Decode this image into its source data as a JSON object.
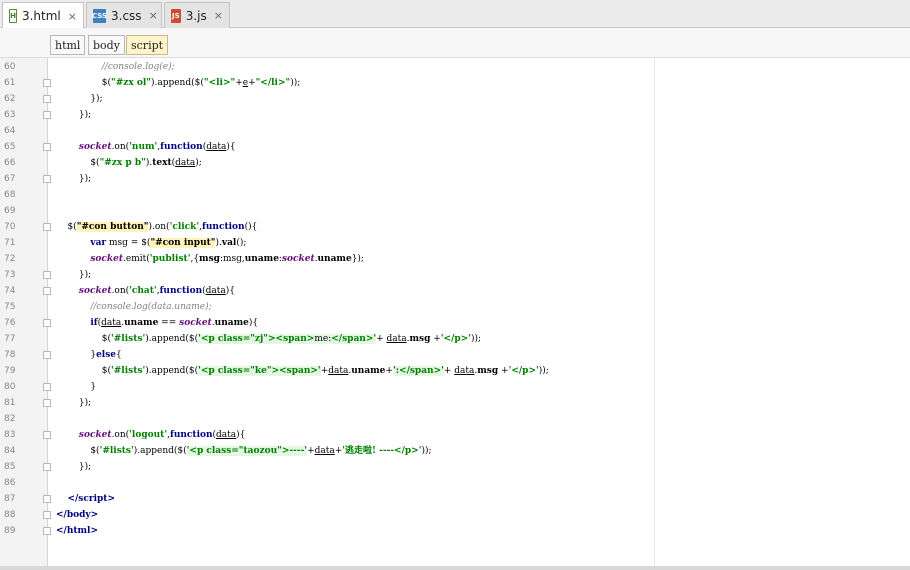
{
  "tabs": [
    {
      "label": "3.html",
      "icon": "html-file-icon",
      "active": true
    },
    {
      "label": "3.css",
      "icon": "css-file-icon",
      "active": false
    },
    {
      "label": "3.js",
      "icon": "js-file-icon",
      "active": false
    }
  ],
  "tab_icon_text": {
    "html": "H",
    "css": "CSS",
    "js": "JS"
  },
  "close_glyph": "×",
  "breadcrumbs": [
    "html",
    "body",
    "script"
  ],
  "code_lines": [
    {
      "n": "60",
      "html": "<span class=\"cmt\">                //console.log(e);</span>"
    },
    {
      "n": "61",
      "html": "                $(<span class=\"str\">\"#zx ol\"</span>).append($(<span class=\"str\">\"&lt;li&gt;\"</span>+<span class=\"ul\">e</span>+<span class=\"str\">\"&lt;/li&gt;\"</span>));"
    },
    {
      "n": "62",
      "html": "            });"
    },
    {
      "n": "63",
      "html": "        });"
    },
    {
      "n": "64",
      "html": ""
    },
    {
      "n": "65",
      "html": "        <span class=\"ital\">socket</span>.on(<span class=\"str\">'num'</span>,<span class=\"kw\">function</span>(<span class=\"ul\">data</span>){"
    },
    {
      "n": "66",
      "html": "            $(<span class=\"str\">\"#zx p b\"</span>).<span class=\"fn\">text</span>(<span class=\"ul\">data</span>);"
    },
    {
      "n": "67",
      "html": "        });"
    },
    {
      "n": "68",
      "html": ""
    },
    {
      "n": "69",
      "html": ""
    },
    {
      "n": "70",
      "html": "    $(<span class=\"sel\">\"#con button\"</span>).on(<span class=\"str\">'click'</span>,<span class=\"kw\">function</span>(){"
    },
    {
      "n": "71",
      "html": "            <span class=\"kw\">var</span> msg = $(<span class=\"sel\">\"#con input\"</span>).<span class=\"fn\">val</span>();"
    },
    {
      "n": "72",
      "html": "            <span class=\"ital\">socket</span>.emit(<span class=\"str\">'publist'</span>,{<span class=\"fn\">msg</span>:msg,<span class=\"fn\">uname</span>:<span class=\"ital\">socket</span>.<span class=\"fn\">uname</span>});"
    },
    {
      "n": "73",
      "html": "        });"
    },
    {
      "n": "74",
      "html": "        <span class=\"ital\">socket</span>.on(<span class=\"str\">'chat'</span>,<span class=\"kw\">function</span>(<span class=\"ul\">data</span>){"
    },
    {
      "n": "75",
      "html": "<span class=\"cmt\">            //console.log(data.uname);</span>"
    },
    {
      "n": "76",
      "html": "            <span class=\"kw\">if</span>(<span class=\"ul\">data</span>.<span class=\"fn\">uname</span> == <span class=\"ital\">socket</span>.<span class=\"fn\">uname</span>){"
    },
    {
      "n": "77",
      "html": "                $(<span class=\"str\">'#lists'</span>).append($(<span class=\"grn\"><span class=\"str\">'&lt;p class=\"zj\"&gt;&lt;span&gt;</span>me:<span class=\"str\">&lt;/span&gt;'</span></span>+ <span class=\"ul\">data</span>.<span class=\"fn\">msg</span> +<span class=\"str\">'&lt;/p&gt;'</span>));"
    },
    {
      "n": "78",
      "html": "            }<span class=\"kw\">else</span>{"
    },
    {
      "n": "79",
      "html": "                $(<span class=\"str\">'#lists'</span>).append($(<span class=\"grn\"><span class=\"str\">'&lt;p class=\"ke\"&gt;&lt;span&gt;'</span></span>+<span class=\"ul\">data</span>.<span class=\"fn\">uname</span>+<span class=\"grn\"><span class=\"str\">':&lt;/span&gt;'</span></span>+ <span class=\"ul\">data</span>.<span class=\"fn\">msg</span> +<span class=\"str\">'&lt;/p&gt;'</span>));"
    },
    {
      "n": "80",
      "html": "            }"
    },
    {
      "n": "81",
      "html": "        });"
    },
    {
      "n": "82",
      "html": ""
    },
    {
      "n": "83",
      "html": "        <span class=\"ital\">socket</span>.on(<span class=\"str\">'logout'</span>,<span class=\"kw\">function</span>(<span class=\"ul\">data</span>){"
    },
    {
      "n": "84",
      "html": "            $(<span class=\"str\">'#lists'</span>).append($(<span class=\"grn\"><span class=\"str\">'&lt;p class=\"taozou\"&gt;----'</span></span>+<span class=\"ul\">data</span>+<span class=\"str\">'逃走啦! ----&lt;/p&gt;'</span>));"
    },
    {
      "n": "85",
      "html": "        });"
    },
    {
      "n": "86",
      "html": ""
    },
    {
      "n": "87",
      "html": "    <span class=\"tag\">&lt;/script&gt;</span>"
    },
    {
      "n": "88",
      "html": "<span class=\"tag\">&lt;/body&gt;</span>"
    },
    {
      "n": "89",
      "html": "<span class=\"tag\">&lt;/html&gt;</span>"
    }
  ],
  "fold_lines": [
    "61",
    "62",
    "63",
    "65",
    "67",
    "70",
    "73",
    "74",
    "76",
    "78",
    "80",
    "81",
    "83",
    "85",
    "87",
    "88",
    "89"
  ]
}
